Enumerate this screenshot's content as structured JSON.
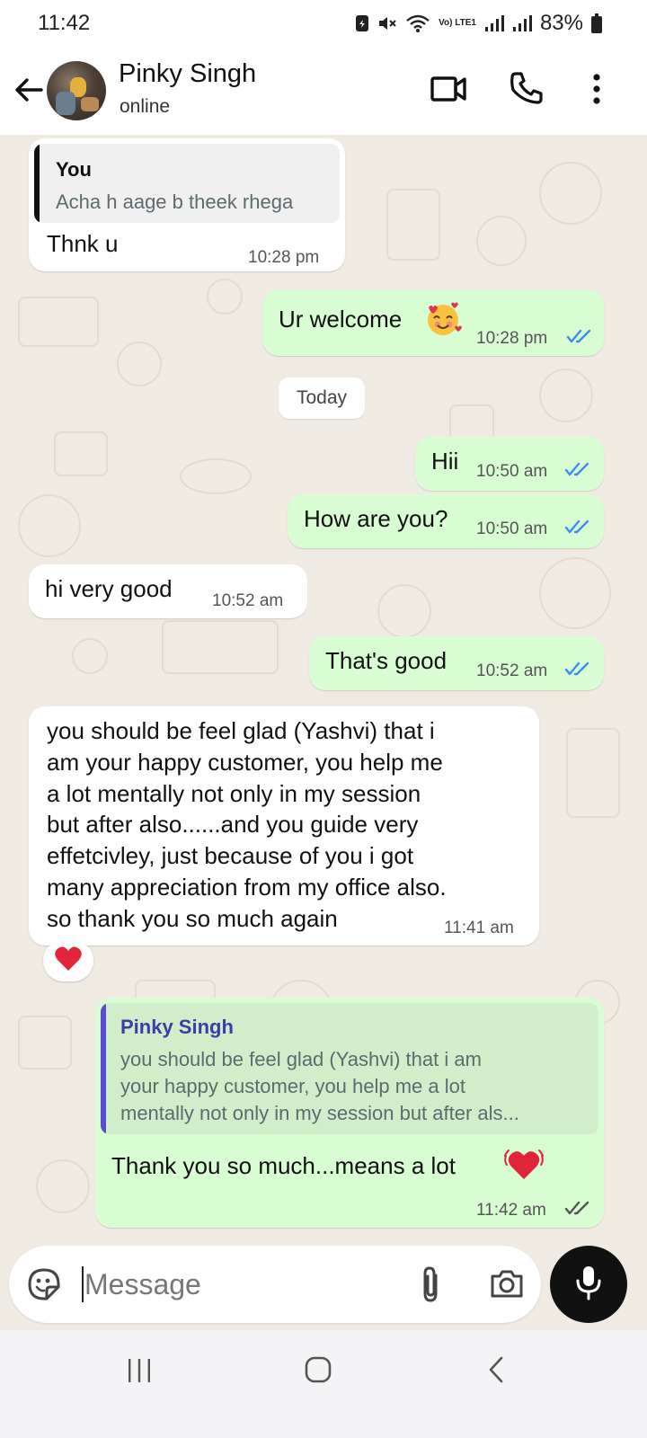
{
  "status_bar": {
    "time": "11:42",
    "battery": "83%",
    "network_label": "Vo) LTE1",
    "icons": [
      "notification-icon",
      "mute-icon",
      "wifi-icon",
      "signal-icon",
      "signal-icon",
      "battery-icon"
    ]
  },
  "header": {
    "contact_name": "Pinky Singh",
    "contact_status": "online",
    "icons": [
      "back-arrow-icon",
      "video-call-icon",
      "phone-call-icon",
      "more-options-icon"
    ]
  },
  "messages": [
    {
      "dir": "in",
      "quote_author": "You",
      "quote_text": "Acha h aage b theek rhega",
      "text": "Thnk u",
      "time": "10:28 pm"
    },
    {
      "dir": "out",
      "text": "Ur welcome",
      "emoji": "smiling-face-with-hearts-icon",
      "time": "10:28 pm",
      "status": "read"
    },
    {
      "type": "date",
      "text": "Today"
    },
    {
      "dir": "out",
      "text": "Hii",
      "time": "10:50 am",
      "status": "read"
    },
    {
      "dir": "out",
      "text": "How are you?",
      "time": "10:50 am",
      "status": "read"
    },
    {
      "dir": "in",
      "text": "hi very good",
      "time": "10:52 am"
    },
    {
      "dir": "out",
      "text": "That's good",
      "time": "10:52 am",
      "status": "read"
    },
    {
      "dir": "in",
      "lines": [
        "you should be feel glad  (Yashvi) that i",
        "am your happy customer, you help me",
        "a lot mentally not only in my session",
        "but after also......and you guide very",
        "effetcivley, just because of you i got",
        "many appreciation from my office also.",
        "so thank you so much again"
      ],
      "time": "11:41 am",
      "reaction": "red-heart-icon"
    },
    {
      "dir": "out",
      "quote_author": "Pinky Singh",
      "quote_lines": [
        "you should be feel glad  (Yashvi) that i am",
        "your happy customer, you help me a lot",
        "mentally not only in my session but after als..."
      ],
      "text": "Thank you so much...means a lot",
      "emoji": "beating-heart-icon",
      "time": "11:42 am",
      "status": "delivered"
    }
  ],
  "composer": {
    "placeholder": "Message",
    "value": "",
    "icons": [
      "sticker-icon",
      "attach-icon",
      "camera-icon",
      "mic-icon"
    ]
  },
  "nav_bar": {
    "icons": [
      "recent-apps-icon",
      "home-icon",
      "back-icon"
    ]
  },
  "colors": {
    "outgoing_bubble": "#d9fdd3",
    "incoming_bubble": "#ffffff",
    "chat_background": "#efeae2",
    "read_ticks": "#3c8df0",
    "quote_bar_you": "#111111",
    "quote_bar_contact": "#5b4ad6",
    "quote_author_contact": "#3a3fa6"
  }
}
